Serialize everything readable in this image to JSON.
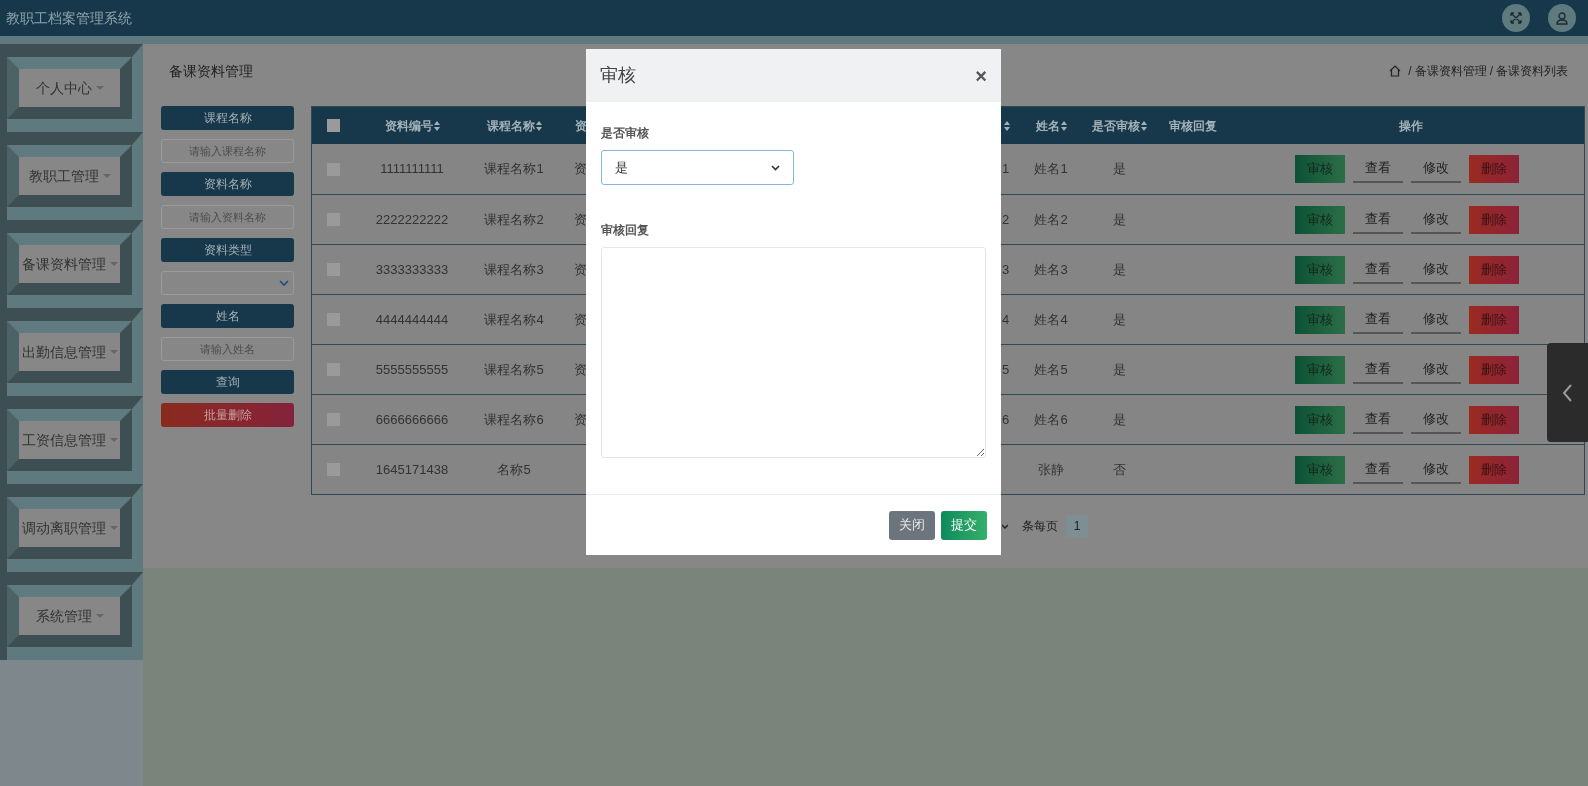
{
  "header": {
    "title": "教职工档案管理系统"
  },
  "sidebar": {
    "items": [
      {
        "label": "个人中心"
      },
      {
        "label": "教职工管理"
      },
      {
        "label": "备课资料管理"
      },
      {
        "label": "出勤信息管理"
      },
      {
        "label": "工资信息管理"
      },
      {
        "label": "调动离职管理"
      },
      {
        "label": "系统管理"
      }
    ]
  },
  "page_title": "备课资料管理",
  "breadcrumb": {
    "separator": "/",
    "items": [
      "备课资料管理",
      "备课资料列表"
    ]
  },
  "filters": [
    {
      "kind": "label",
      "text": "课程名称"
    },
    {
      "kind": "input",
      "placeholder": "请输入课程名称"
    },
    {
      "kind": "label",
      "text": "资料名称"
    },
    {
      "kind": "input",
      "placeholder": "请输入资料名称"
    },
    {
      "kind": "label",
      "text": "资料类型"
    },
    {
      "kind": "select"
    },
    {
      "kind": "label",
      "text": "姓名"
    },
    {
      "kind": "input",
      "placeholder": "请输入姓名"
    },
    {
      "kind": "search",
      "text": "查询"
    },
    {
      "kind": "danger",
      "text": "批量删除"
    }
  ],
  "table": {
    "select_all": {
      "checked": false
    },
    "columns": [
      {
        "label": "资料编号",
        "sortable": true
      },
      {
        "label": "课程名称",
        "sortable": true
      },
      {
        "label": "资",
        "sortable": false
      },
      {
        "sortable": true
      },
      {
        "label": "姓名",
        "sortable": true
      },
      {
        "label": "是否审核",
        "sortable": true
      },
      {
        "label": "审核回复",
        "sortable": false
      },
      {
        "kind": "actions",
        "label": "操作"
      }
    ],
    "rows": [
      {
        "checked": false,
        "cells": [
          "1111111111",
          "课程名称1",
          "资",
          "1",
          "姓名1",
          "是"
        ],
        "actions": [
          {
            "kind": "review",
            "label": "审核"
          },
          {
            "kind": "view",
            "label": "查看"
          },
          {
            "kind": "edit",
            "label": "修改"
          },
          {
            "kind": "delete",
            "label": "删除"
          }
        ]
      },
      {
        "checked": false,
        "cells": [
          "2222222222",
          "课程名称2",
          "资",
          "2",
          "姓名2",
          "是"
        ],
        "actions": [
          {
            "kind": "review",
            "label": "审核"
          },
          {
            "kind": "view",
            "label": "查看"
          },
          {
            "kind": "edit",
            "label": "修改"
          },
          {
            "kind": "delete",
            "label": "删除"
          }
        ]
      },
      {
        "checked": false,
        "cells": [
          "3333333333",
          "课程名称3",
          "资",
          "3",
          "姓名3",
          "是"
        ],
        "actions": [
          {
            "kind": "review",
            "label": "审核"
          },
          {
            "kind": "view",
            "label": "查看"
          },
          {
            "kind": "edit",
            "label": "修改"
          },
          {
            "kind": "delete",
            "label": "删除"
          }
        ]
      },
      {
        "checked": false,
        "cells": [
          "4444444444",
          "课程名称4",
          "资",
          "4",
          "姓名4",
          "是"
        ],
        "actions": [
          {
            "kind": "review",
            "label": "审核"
          },
          {
            "kind": "view",
            "label": "查看"
          },
          {
            "kind": "edit",
            "label": "修改"
          },
          {
            "kind": "delete",
            "label": "删除"
          }
        ]
      },
      {
        "checked": false,
        "cells": [
          "5555555555",
          "课程名称5",
          "资",
          "5",
          "姓名5",
          "是"
        ],
        "actions": [
          {
            "kind": "review",
            "label": "审核"
          },
          {
            "kind": "view",
            "label": "查看"
          },
          {
            "kind": "edit",
            "label": "修改"
          },
          {
            "kind": "delete",
            "label": "删除"
          }
        ]
      },
      {
        "checked": false,
        "cells": [
          "6666666666",
          "课程名称6",
          "资",
          "6",
          "姓名6",
          "是"
        ],
        "actions": [
          {
            "kind": "review",
            "label": "审核"
          },
          {
            "kind": "view",
            "label": "查看"
          },
          {
            "kind": "edit",
            "label": "修改"
          },
          {
            "kind": "delete",
            "label": "删除"
          }
        ]
      },
      {
        "checked": false,
        "cells": [
          "1645171438",
          "名称5",
          null,
          null,
          "张静",
          "否"
        ],
        "actions": [
          {
            "kind": "review",
            "label": "审核"
          },
          {
            "kind": "view",
            "label": "查看"
          },
          {
            "kind": "edit",
            "label": "修改"
          },
          {
            "kind": "delete",
            "label": "删除"
          }
        ]
      }
    ]
  },
  "pagination": {
    "page_size_label": "条每页",
    "pages": [
      {
        "label": "1",
        "selected": true
      }
    ]
  },
  "modal": {
    "title": "审核",
    "close": "×",
    "fields": [
      {
        "kind": "select",
        "label": "是否审核",
        "value": "是"
      },
      {
        "kind": "textarea",
        "label": "审核回复"
      }
    ],
    "buttons": [
      {
        "kind": "secondary",
        "label": "关闭"
      },
      {
        "kind": "primary",
        "label": "提交"
      }
    ]
  }
}
